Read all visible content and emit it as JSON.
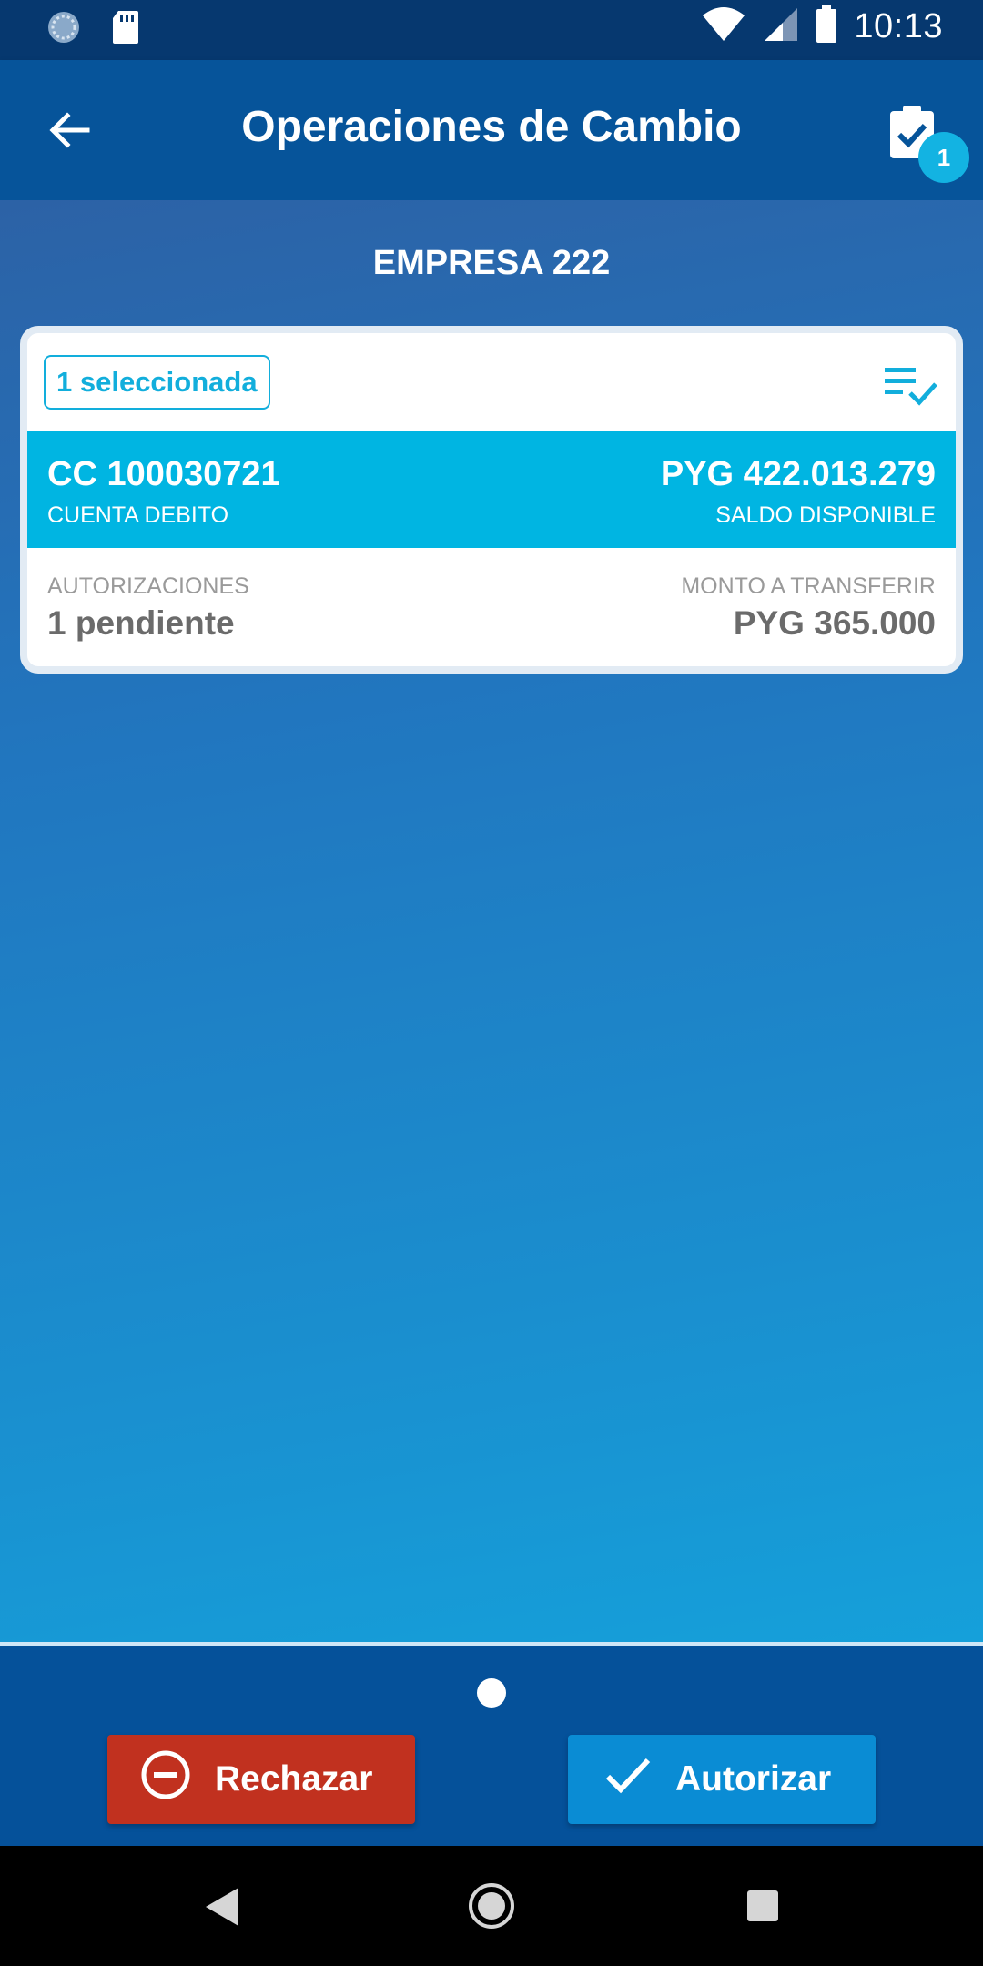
{
  "status_bar": {
    "time": "10:13",
    "icons": [
      "sync-icon",
      "sd-card-icon",
      "wifi-icon",
      "cell-signal-icon",
      "battery-icon"
    ]
  },
  "app_bar": {
    "title": "Operaciones de Cambio",
    "back_icon": "arrow-back-icon",
    "tasks_icon": "clipboard-check-icon",
    "tasks_badge": "1"
  },
  "company": {
    "name": "EMPRESA 222"
  },
  "card": {
    "selected_chip": "1 seleccionada",
    "select_all_icon": "list-check-icon",
    "account": {
      "number": "CC 100030721",
      "type_label": "CUENTA DEBITO",
      "balance": "PYG 422.013.279",
      "balance_label": "SALDO DISPONIBLE"
    },
    "authorizations_label": "AUTORIZACIONES",
    "authorizations_value": "1 pendiente",
    "amount_label": "MONTO A TRANSFERIR",
    "amount_value": "PYG 365.000"
  },
  "actions": {
    "reject_label": "Rechazar",
    "authorize_label": "Autorizar"
  },
  "colors": {
    "status_bar": "#06386f",
    "app_bar": "#06549a",
    "accent": "#00b5e2",
    "reject": "#c1311f",
    "authorize": "#0a8cd4"
  }
}
